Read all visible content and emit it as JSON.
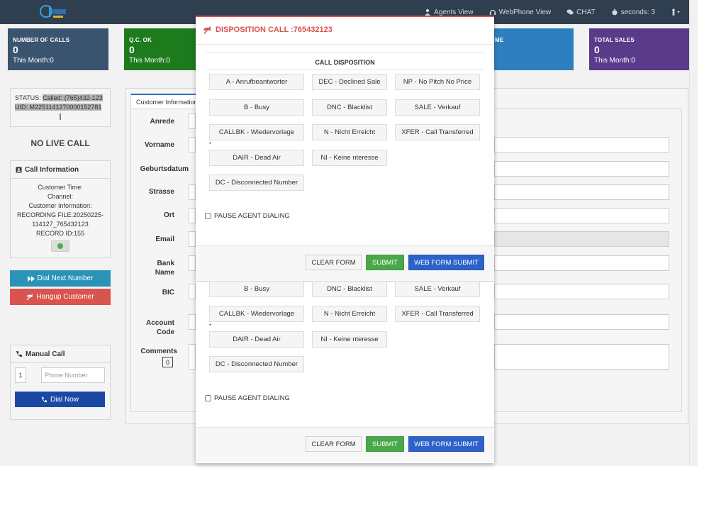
{
  "nav": {
    "items": [
      {
        "label": "Agents View",
        "icon": "user-icon"
      },
      {
        "label": "WebPhone View",
        "icon": "headset-icon"
      },
      {
        "label": "CHAT",
        "icon": "chat-icon"
      },
      {
        "label": "seconds: 3",
        "icon": "stopwatch-icon"
      },
      {
        "label": "",
        "icon": "person-dropdown-icon"
      }
    ]
  },
  "stats": {
    "calls": {
      "label": "NUMBER OF CALLS",
      "value": "0",
      "month": "This Month:0",
      "color": "#3a5470"
    },
    "qc": {
      "label": "Q.C. OK",
      "value": "0",
      "month": "This Month:0",
      "color": "#1d7a1d"
    },
    "third": {
      "label": "ME",
      "color": "#2e7fbf"
    },
    "sales": {
      "label": "TOTAL SALES",
      "value": "0",
      "month": "This Month:0",
      "color": "#5a3b8a"
    }
  },
  "status": {
    "line1_prefix": "STATUS: ",
    "line1_value": "Called: (765)432-123",
    "line2_value": "UID: M2251141270000152781",
    "line3_value": "|"
  },
  "no_live_call": "NO LIVE CALL",
  "call_info": {
    "title": "Call Information",
    "lines": [
      "Customer Time:",
      "Channel:",
      "Customer Information:",
      "RECORDING FILE:20250225-",
      "114127_765432123",
      "RECORD ID:155"
    ]
  },
  "buttons": {
    "dial_next": "Dial Next Number",
    "hangup": "Hangup Customer",
    "dial_next_color": "#2b93b8",
    "hangup_color": "#d9534f"
  },
  "manual_call": {
    "title": "Manual Call",
    "code": "1",
    "phone_placeholder": "Phone Number",
    "dial_now": "Dial Now"
  },
  "customer_tab": "Customer Information",
  "form": {
    "labels": {
      "anrede": "Anrede",
      "vorname": "Vorname",
      "geburtsdatum": "Geburtsdatum",
      "strasse": "Strasse",
      "ort": "Ort",
      "email": "Email",
      "bank_name_1": "Bank",
      "bank_name_2": "Name",
      "bic": "BIC",
      "account_code_1": "Account",
      "account_code_2": "Code",
      "comments": "Comments"
    },
    "comments_count": "0"
  },
  "modal": {
    "title": "DISPOSITION CALL :765432123",
    "section_title": "CALL DISPOSITION",
    "dispositions": [
      "A - Anrufbeantworter",
      "DEC - Declined Sale",
      "NP - No Pitch No Price",
      "B - Busy",
      "DNC - Blacklist",
      "SALE - Verkauf",
      "CALLBK - Wiedervorlage",
      "N - Nicht Erreicht",
      "XFER - Call Transferred",
      "DAIR - Dead Air",
      "NI - Keine nteresse",
      "DC - Disconnected Number"
    ],
    "asterisk": "*",
    "pause_label": "PAUSE AGENT DIALING",
    "clear": "CLEAR FORM",
    "submit": "SUBMIT",
    "web_submit": "WEB FORM SUBMIT"
  }
}
